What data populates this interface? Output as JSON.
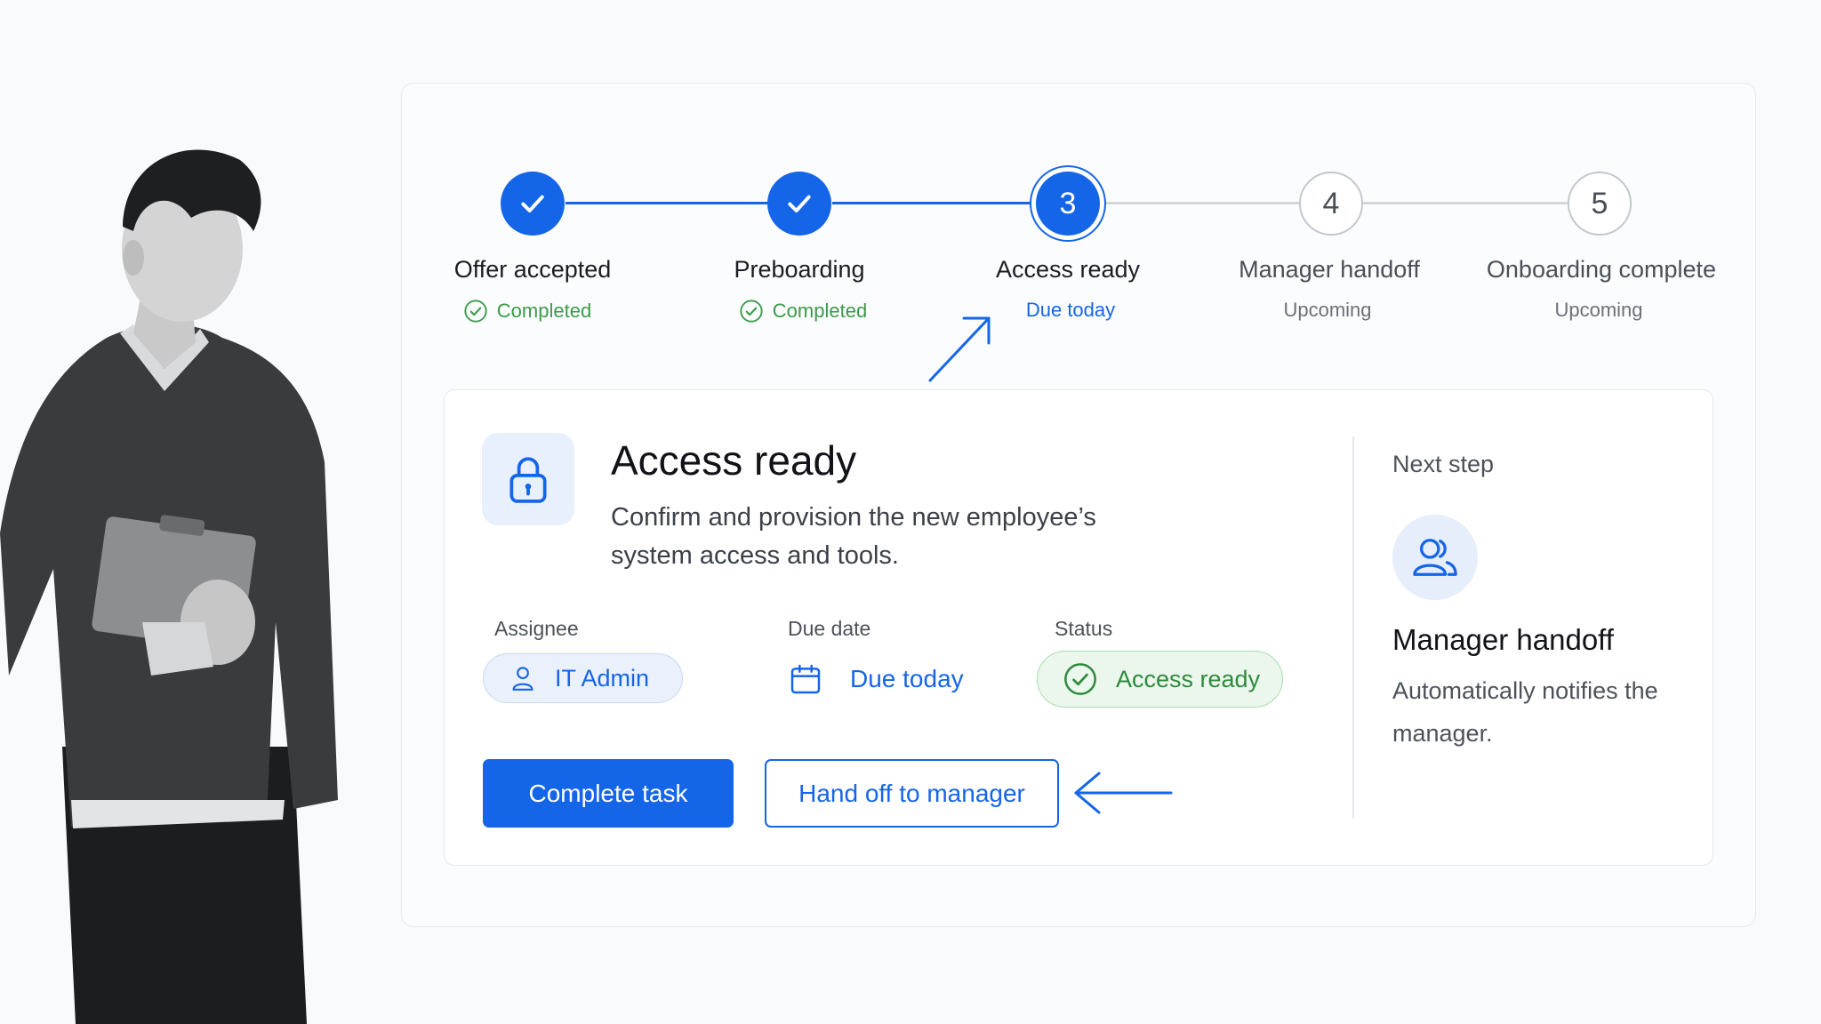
{
  "colors": {
    "accent": "#1565e8",
    "success": "#3a9b4a",
    "muted": "#6b7079",
    "line_inactive": "#d3d7dd"
  },
  "stepper": {
    "steps": [
      {
        "marker": "check-icon",
        "title": "Offer accepted",
        "status": "Completed",
        "state": "done"
      },
      {
        "marker": "check-icon",
        "title": "Preboarding",
        "status": "Completed",
        "state": "done"
      },
      {
        "marker": "3",
        "title": "Access ready",
        "status": "Due today",
        "state": "current"
      },
      {
        "marker": "4",
        "title": "Manager handoff",
        "status": "Upcoming",
        "state": "upcoming"
      },
      {
        "marker": "5",
        "title": "Onboarding complete",
        "status": "Upcoming",
        "state": "upcoming"
      }
    ]
  },
  "task": {
    "icon": "lock-icon",
    "title": "Access ready",
    "description": "Confirm and provision the new employee’s system access and tools.",
    "assignee_label": "Assignee",
    "assignee": "IT Admin",
    "assignee_icon": "user-icon",
    "due_label": "Due date",
    "due": "Due today",
    "due_icon": "calendar-icon",
    "status_label": "Status",
    "status": "Access ready",
    "status_icon": "check-circle-icon",
    "primary_action": "Complete task",
    "secondary_action": "Hand off to manager"
  },
  "next_step": {
    "label": "Next step",
    "icon": "users-icon",
    "title": "Manager handoff",
    "description": "Automatically notifies the manager."
  }
}
